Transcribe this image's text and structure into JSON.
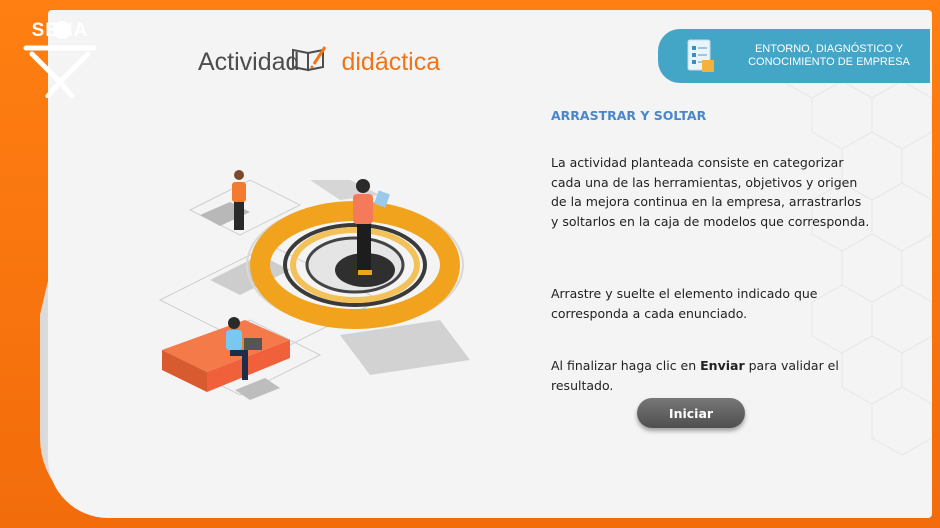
{
  "logo": {
    "text": "SENA"
  },
  "title": {
    "part1": "Actividad",
    "part2": "didáctica"
  },
  "topic": {
    "line1": "ENTORNO, DIAGNÓSTICO Y",
    "line2": "CONOCIMIENTO DE EMPRESA"
  },
  "content": {
    "heading": "ARRASTRAR Y SOLTAR",
    "paragraph1": "La actividad planteada consiste en categorizar cada una de las herramientas, objetivos y origen de la mejora continua en la empresa, arrastrarlos y soltarlos en la caja de modelos que corresponda.",
    "paragraph2": "Arrastre y suelte el elemento indicado que corresponda a cada enunciado.",
    "paragraph3_pre": "Al finalizar haga clic en ",
    "paragraph3_bold": "Enviar",
    "paragraph3_post": " para validar el resultado."
  },
  "button": {
    "label": "Iniciar"
  },
  "colors": {
    "brand_orange": "#f47a14",
    "accent_blue": "#44a6c6",
    "heading_blue": "#4a86c8"
  }
}
